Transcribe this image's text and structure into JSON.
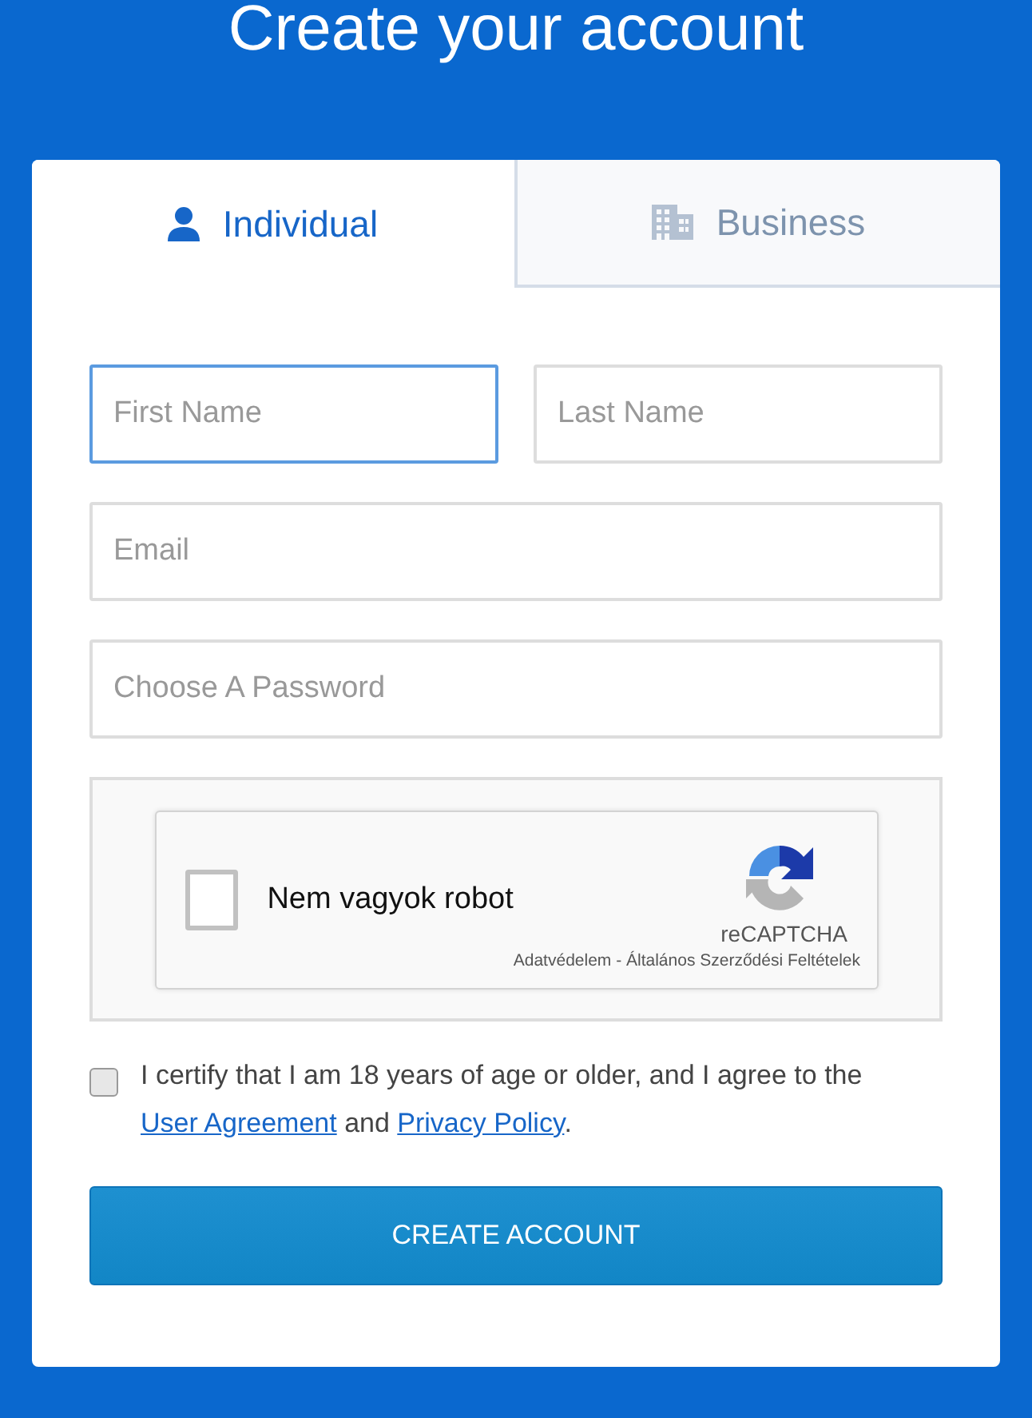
{
  "title": "Create your account",
  "tabs": [
    {
      "label": "Individual",
      "kind": "person",
      "selected": true
    },
    {
      "label": "Business",
      "kind": "building",
      "selected": false
    }
  ],
  "fields": [
    {
      "placeholder": "First Name",
      "focused": true,
      "half": true
    },
    {
      "placeholder": "Last Name",
      "focused": false,
      "half": true
    },
    {
      "placeholder": "Email",
      "focused": false,
      "half": false
    },
    {
      "placeholder": "Choose A Password",
      "focused": false,
      "half": false
    }
  ],
  "captcha": {
    "label": "Nem vagyok robot",
    "checked": false,
    "brand": "reCAPTCHA",
    "footer": "Adatvédelem - Általános Szerződési Feltételek"
  },
  "certify": {
    "checked": false,
    "text_before": "I certify that I am 18 years of age or older, and I agree to the",
    "link_1": "User Agreement",
    "middle": "and",
    "link_2": "Privacy Policy",
    "text_after": "."
  },
  "submit": "CREATE ACCOUNT"
}
